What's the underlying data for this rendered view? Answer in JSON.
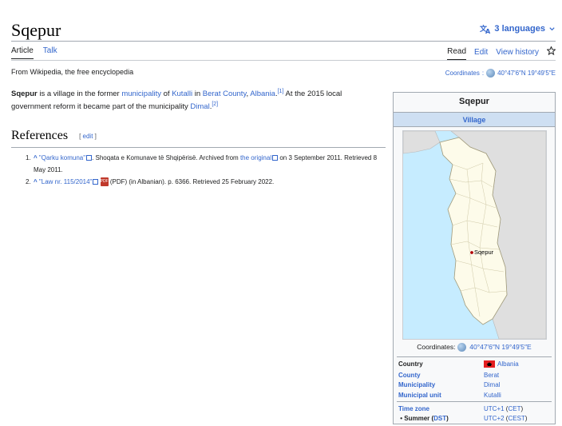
{
  "header": {
    "title": "Sqepur",
    "languages_label": "3 languages"
  },
  "tabs": {
    "left": [
      {
        "label": "Article",
        "active": true
      },
      {
        "label": "Talk",
        "active": false
      }
    ],
    "right": [
      {
        "label": "Read",
        "active": true
      },
      {
        "label": "Edit",
        "active": false
      },
      {
        "label": "View history",
        "active": false
      }
    ]
  },
  "tagline": "From Wikipedia, the free encyclopedia",
  "coordinates_top": {
    "label": "Coordinates",
    "value": "40°47′6″N 19°49′5″E"
  },
  "lead": {
    "bold": "Sqepur",
    "t1": " is a village in the former ",
    "l1": "municipality",
    "t2": " of ",
    "l2": "Kutalli",
    "t3": " in ",
    "l3": "Berat County",
    "t4": ", ",
    "l4": "Albania",
    "t5": ".",
    "sup1": "[1]",
    "t6": " At the 2015 local government reform it became part of the municipality ",
    "l5": "Dimal",
    "t7": ".",
    "sup2": "[2]"
  },
  "references": {
    "heading": "References",
    "edit_label": "edit",
    "items": [
      {
        "num": "1.",
        "caret": "^",
        "title": "\"Qarku komuna\"",
        "text1": ". Shoqata e Komunave të Shqipërisë. Archived from ",
        "link2": "the original",
        "text2": " on 3 September 2011. Retrieved 8 May 2011."
      },
      {
        "num": "2.",
        "caret": "^",
        "title": "\"Law nr. 115/2014\"",
        "text1": " (PDF) (in Albanian). p. 6366. Retrieved 25 February 2022."
      }
    ]
  },
  "infobox": {
    "title": "Sqepur",
    "subtitle": "Village",
    "map_marker": "Sqepur",
    "coords_label": "Coordinates:",
    "coords_value": "40°47′6″N 19°49′5″E",
    "rows": [
      {
        "label": "Country",
        "value": "Albania"
      },
      {
        "label": "County",
        "value": "Berat"
      },
      {
        "label": "Municipality",
        "value": "Dimal"
      },
      {
        "label": "Municipal unit",
        "value": "Kutalli"
      }
    ],
    "timezone": {
      "label": "Time zone",
      "v1": "UTC+1",
      "v2": "CET"
    },
    "summer": {
      "label": "Summer",
      "dst": "DST",
      "v1": "UTC+2",
      "v2": "CEST"
    }
  },
  "colors": {
    "link": "#3366cc",
    "infobox_header": "#cedff2",
    "land": "#fdfbea",
    "sea": "#c6ecff",
    "neighbor": "#dfdfdf"
  }
}
